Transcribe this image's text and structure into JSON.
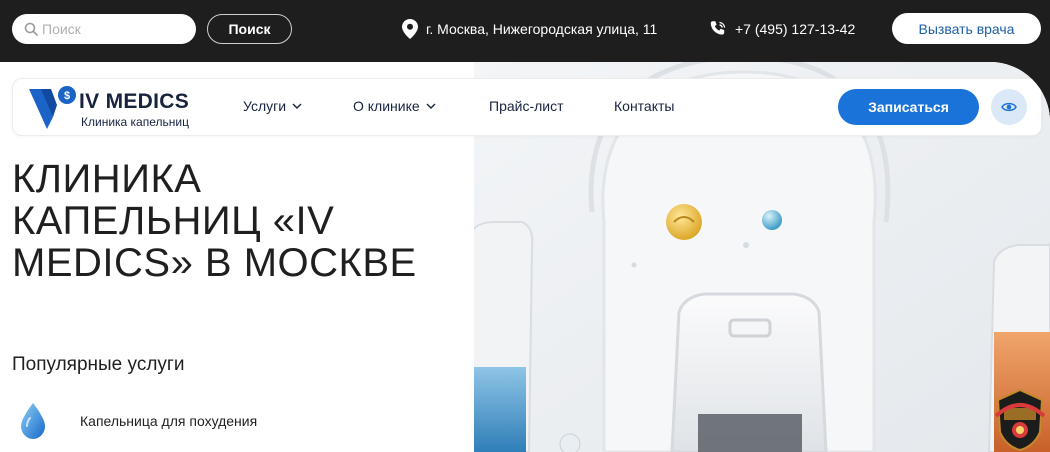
{
  "topbar": {
    "search_placeholder": "Поиск",
    "search_button": "Поиск",
    "address": "г. Москва, Нижегородская улица, 11",
    "phone": "+7 (495) 127-13-42",
    "call_doctor": "Вызвать врача"
  },
  "logo": {
    "name": "IV MEDICS",
    "subtitle": "Клиника капельниц"
  },
  "nav": {
    "items": [
      {
        "label": "Услуги",
        "has_dropdown": true
      },
      {
        "label": "О клинике",
        "has_dropdown": true
      },
      {
        "label": "Прайс-лист",
        "has_dropdown": false
      },
      {
        "label": "Контакты",
        "has_dropdown": false
      }
    ],
    "signup": "Записаться",
    "accessibility_icon": "eye-icon"
  },
  "hero": {
    "title": "Клиника капельниц «IV MEDICS» в Москве",
    "services_heading": "Популярные услуги",
    "services": [
      {
        "label": "Капельница для похудения",
        "icon": "water-drop-icon"
      }
    ]
  },
  "colors": {
    "dark": "#1e1e1e",
    "accent_blue": "#1a73d9",
    "brand_navy": "#17233f",
    "eye_bg": "#dbe8f7"
  }
}
